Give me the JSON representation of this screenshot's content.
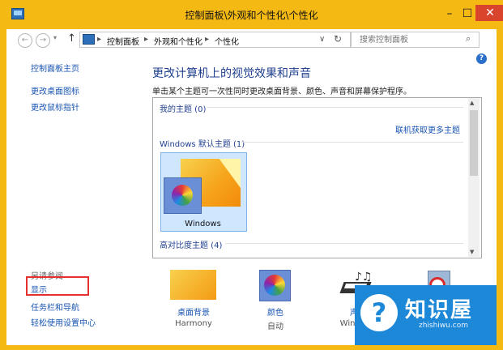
{
  "window": {
    "title": "控制面板\\外观和个性化\\个性化",
    "minimize_glyph": "–",
    "maximize_glyph": "☐",
    "close_glyph": "✕"
  },
  "nav": {
    "back_glyph": "←",
    "forward_glyph": "→",
    "up_glyph": "↑",
    "breadcrumb": [
      "控制面板",
      "外观和个性化",
      "个性化"
    ],
    "separator": "▸",
    "dropdown_glyph": "∨",
    "refresh_glyph": "↻",
    "search_placeholder": "搜索控制面板",
    "search_glyph": "⌕",
    "help_glyph": "?"
  },
  "sidebar": {
    "links": [
      "控制面板主页",
      "更改桌面图标",
      "更改鼠标指针"
    ],
    "see_also_title": "另请参阅",
    "see_also": [
      "显示",
      "任务栏和导航",
      "轻松使用设置中心"
    ]
  },
  "main": {
    "heading": "更改计算机上的视觉效果和声音",
    "subtext": "单击某个主题可一次性同时更改桌面背景、颜色、声音和屏幕保护程序。",
    "my_themes": "我的主题 (0)",
    "get_more_link": "联机获取更多主题",
    "default_themes": "Windows 默认主题 (1)",
    "theme_name": "Windows",
    "high_contrast": "高对比度主题 (4)",
    "scroll_up": "▲",
    "scroll_down": "▼"
  },
  "bottom_items": [
    {
      "label": "桌面背景",
      "value": "Harmony"
    },
    {
      "label": "颜色",
      "value": "自动"
    },
    {
      "label": "声音",
      "value": "Windows"
    },
    {
      "label": "",
      "value": ""
    }
  ],
  "watermark": {
    "title": "知识屋",
    "subtitle": "zhishiwu.com",
    "glyph": "?"
  }
}
